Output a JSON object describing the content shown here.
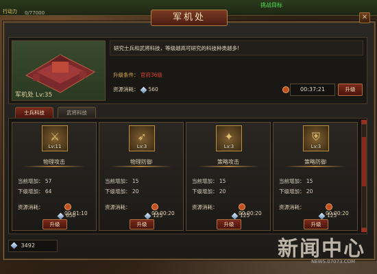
{
  "topbar": {
    "left_text": "行动力",
    "counter": "0/77000",
    "right_text": "挑战目标"
  },
  "window": {
    "title": "军机处",
    "close_icon": "close-icon"
  },
  "building": {
    "name": "军机处 Lv:35",
    "description": "研究士兵和武将科技，等级越高可研究的科技种类越多!",
    "condition_label": "升级条件：",
    "condition_value": "官府36级",
    "resource_label": "资源消耗：",
    "resource_value": "560",
    "timer": "00:37:21",
    "upgrade_label": "升级"
  },
  "tabs": [
    {
      "label": "士兵科技",
      "active": true
    },
    {
      "label": "武将科技",
      "active": false
    }
  ],
  "cards": [
    {
      "name": "物理攻击",
      "level": "Lv:11",
      "current_label": "当前增加：",
      "current_value": "57",
      "next_label": "下级增加：",
      "next_value": "64",
      "res_label": "资源消耗：",
      "time": "00:01:10",
      "cost": "650",
      "upgrade_label": "升级"
    },
    {
      "name": "物理防御",
      "level": "Lv:3",
      "current_label": "当前增加：",
      "current_value": "15",
      "next_label": "下级增加：",
      "next_value": "20",
      "res_label": "资源消耗：",
      "time": "00:00:20",
      "cost": "125",
      "upgrade_label": "升级"
    },
    {
      "name": "策略攻击",
      "level": "Lv:3",
      "current_label": "当前增加：",
      "current_value": "15",
      "next_label": "下级增加：",
      "next_value": "20",
      "res_label": "资源消耗：",
      "time": "00:00:20",
      "cost": "125",
      "upgrade_label": "升级"
    },
    {
      "name": "策略防御",
      "level": "Lv:3",
      "current_label": "当前增加：",
      "current_value": "15",
      "next_label": "下级增加：",
      "next_value": "20",
      "res_label": "资源消耗：",
      "time": "00:00:20",
      "cost": "125",
      "upgrade_label": "升级"
    }
  ],
  "bottom": {
    "resource_total": "3492"
  },
  "watermark": {
    "text": "新闻中心",
    "site": "NEWS.07073.COM"
  }
}
